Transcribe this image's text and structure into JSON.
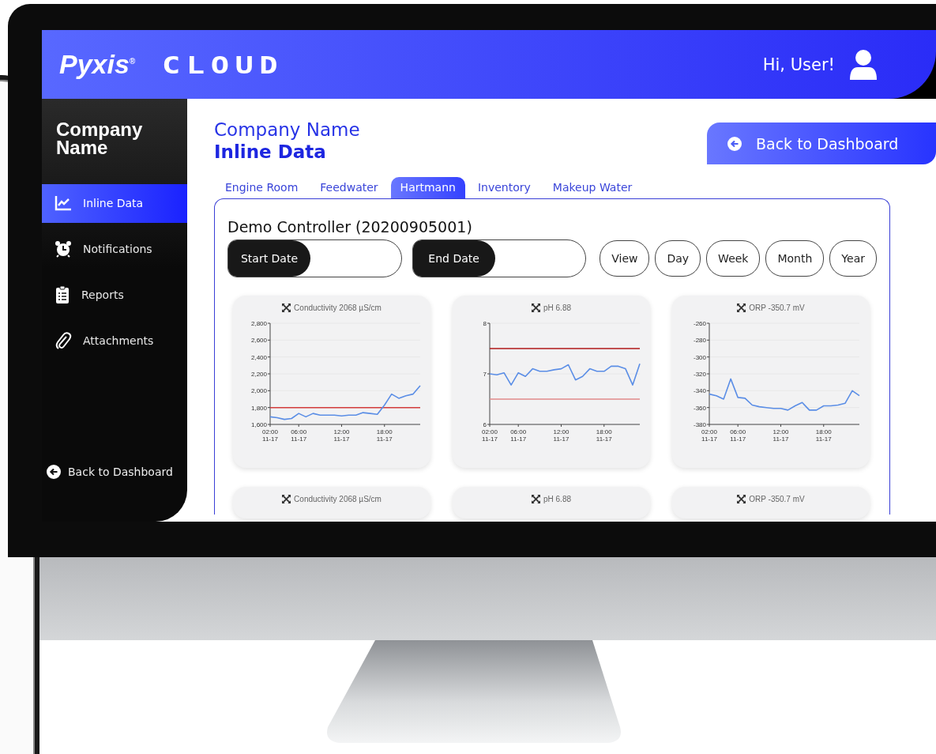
{
  "header": {
    "brand": "Pyxis$^{®}$",
    "product": "CLOUD",
    "greeting": "Hi, User!"
  },
  "sidebar": {
    "company": "Company Name",
    "items": [
      {
        "label": "Inline Data",
        "selected": true
      },
      {
        "label": "Notifications",
        "selected": false
      },
      {
        "label": "Reports",
        "selected": false
      },
      {
        "label": "Attachments",
        "selected": false
      }
    ],
    "back_link": "Back to Dashboard"
  },
  "page": {
    "company": "Company Name",
    "title": "Inline Data",
    "back_button": "Back to Dashboard"
  },
  "tabs": [
    {
      "label": "Engine Room",
      "selected": false
    },
    {
      "label": "Feedwater",
      "selected": false
    },
    {
      "label": "Hartmann",
      "selected": true
    },
    {
      "label": "Inventory",
      "selected": false
    },
    {
      "label": "Makeup Water",
      "selected": false
    }
  ],
  "controller": {
    "title": "Demo Controller (20200905001)",
    "start_label": "Start Date",
    "end_label": "End Date",
    "buttons": [
      "View",
      "Day",
      "Week",
      "Month",
      "Year"
    ]
  },
  "charts": [
    {
      "title": "Conductivity 2068 µS/cm",
      "chart_data": {
        "type": "line",
        "categories": [
          "02:00 11-17",
          null,
          null,
          null,
          "06:00 11-17",
          null,
          null,
          null,
          null,
          null,
          "12:00 11-17",
          null,
          null,
          null,
          null,
          null,
          "18:00 11-17",
          null,
          null,
          null,
          null,
          null
        ],
        "ylim": [
          1600,
          2800
        ],
        "yticks": [
          {
            "value": 1600,
            "label": "1,600"
          },
          {
            "value": 1800,
            "label": "1,800"
          },
          {
            "value": 2000,
            "label": "2,000"
          },
          {
            "value": 2200,
            "label": "2,200"
          },
          {
            "value": 2400,
            "label": "2,400"
          },
          {
            "value": 2600,
            "label": "2,600"
          },
          {
            "value": 2800,
            "label": "2,800"
          }
        ],
        "series": [
          {
            "color": "#d23b3b",
            "values": [
              1800,
              1800,
              1800,
              1800,
              1800,
              1800,
              1800,
              1800,
              1800,
              1800,
              1800,
              1800,
              1800,
              1800,
              1800,
              1800,
              1800,
              1800,
              1800,
              1800,
              1800,
              1800
            ]
          },
          {
            "color": "#5b8ee6",
            "values": [
              1690,
              1680,
              1660,
              1670,
              1730,
              1690,
              1730,
              1710,
              1710,
              1710,
              1700,
              1710,
              1710,
              1740,
              1730,
              1720,
              1830,
              1960,
              1910,
              1940,
              1960,
              2060
            ]
          }
        ],
        "grid": true
      }
    },
    {
      "title": "pH 6.88",
      "chart_data": {
        "type": "line",
        "categories": [
          "02:00 11-17",
          null,
          null,
          null,
          "06:00 11-17",
          null,
          null,
          null,
          null,
          null,
          "12:00 11-17",
          null,
          null,
          null,
          null,
          null,
          "18:00 11-17",
          null,
          null,
          null,
          null,
          null
        ],
        "ylim": [
          6,
          8
        ],
        "yticks": [
          6,
          7,
          8
        ],
        "series": [
          {
            "color": "#b01818",
            "values": [
              7.5,
              7.5,
              7.5,
              7.5,
              7.5,
              7.5,
              7.5,
              7.5,
              7.5,
              7.5,
              7.5,
              7.5,
              7.5,
              7.5,
              7.5,
              7.5,
              7.5,
              7.5,
              7.5,
              7.5,
              7.5,
              7.5
            ]
          },
          {
            "color": "#e08a8a",
            "values": [
              6.5,
              6.5,
              6.5,
              6.5,
              6.5,
              6.5,
              6.5,
              6.5,
              6.5,
              6.5,
              6.5,
              6.5,
              6.5,
              6.5,
              6.5,
              6.5,
              6.5,
              6.5,
              6.5,
              6.5,
              6.5,
              6.5
            ]
          },
          {
            "color": "#5b8ee6",
            "values": [
              7.0,
              6.98,
              7.02,
              6.78,
              7.02,
              6.95,
              7.1,
              7.05,
              7.05,
              7.08,
              7.1,
              7.18,
              6.88,
              6.95,
              7.1,
              7.05,
              7.05,
              7.15,
              7.15,
              7.1,
              6.78,
              7.2
            ]
          }
        ],
        "grid": true
      }
    },
    {
      "title": "ORP -350.7 mV",
      "chart_data": {
        "type": "line",
        "categories": [
          "02:00 11-17",
          null,
          null,
          null,
          "06:00 11-17",
          null,
          null,
          null,
          null,
          null,
          "12:00 11-17",
          null,
          null,
          null,
          null,
          null,
          "18:00 11-17",
          null,
          null,
          null,
          null,
          null
        ],
        "ylim": [
          -380,
          -260
        ],
        "yticks": [
          -380,
          -360,
          -340,
          -320,
          -300,
          -280,
          -260
        ],
        "grid": true,
        "series": [
          {
            "color": "#5b8ee6",
            "values": [
              -344,
              -346,
              -350,
              -326,
              -348,
              -349,
              -357,
              -359,
              -360,
              -361,
              -361,
              -363,
              -358,
              -354,
              -363,
              -363,
              -358,
              -358,
              -357,
              -355,
              -340,
              -346
            ]
          }
        ]
      }
    }
  ],
  "more_charts": [
    {
      "title": "Conductivity 2068 µS/cm"
    },
    {
      "title": "pH 6.88"
    },
    {
      "title": "ORP -350.7 mV"
    }
  ]
}
